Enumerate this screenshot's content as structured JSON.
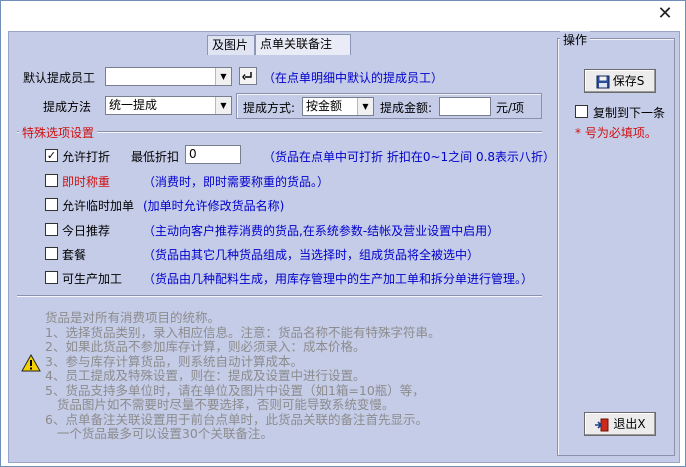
{
  "window": {
    "close_symbol": "✕"
  },
  "tabs": [
    {
      "label": "及图片"
    },
    {
      "label": "点单关联备注"
    }
  ],
  "default_staff": {
    "label": "默认提成员工",
    "value": "",
    "hint": "（在点单明细中默认的提成员工）"
  },
  "commission": {
    "method_label": "提成方法",
    "method_value": "统一提成",
    "mode_label": "提成方式:",
    "mode_value": "按金额",
    "amount_label": "提成金额:",
    "amount_value": "",
    "unit": "元/项"
  },
  "special_options": {
    "title": "特殊选项设置",
    "allow_discount": {
      "label": "允许打折",
      "checked": true,
      "checkmark": "✓"
    },
    "min_discount": {
      "label": "最低折扣",
      "value": "0"
    },
    "discount_hint": "（货品在点单中可打折 折扣在0~1之间 0.8表示八折）",
    "weigh": {
      "label": "即时称重",
      "hint": "（消费时，即时需要称重的货品。）"
    },
    "temp_add": {
      "label": "允许临时加单",
      "hint": "(加单时允许修改货品名称)"
    },
    "today_recommend": {
      "label": "今日推荐",
      "hint": "（主动向客户推荐消费的货品,在系统参数-结帐及营业设置中启用）"
    },
    "combo": {
      "label": "套餐",
      "hint": "（货品由其它几种货品组成，当选择时，组成货品将全被选中）"
    },
    "producible": {
      "label": "可生产加工",
      "hint": "（货品由几种配料生成，用库存管理中的生产加工单和拆分单进行管理。）"
    }
  },
  "help_text": "货品是对所有消费项目的统称。\n1、选择货品类别，录入相应信息。注意：货品名称不能有特殊字符串。\n2、如果此货品不参加库存计算，则必须录入：成本价格。\n3、参与库存计算货品，则系统自动计算成本。\n4、员工提成及特殊设置，则在：提成及设置中进行设置。\n5、货品支持多单位时，请在单位及图片中设置（如1箱=10瓶）等，\n   货品图片如不需要时尽量不要选择，否则可能导致系统变慢。\n6、点单备注关联设置用于前台点单时，此货品关联的备注首先显示。\n   一个货品最多可以设置30个关联备注。",
  "operations": {
    "title": "操作",
    "save_label": "保存S",
    "copy_next_label": "复制到下一条",
    "required_note": "* 号为必填项。",
    "exit_label": "退出X"
  }
}
